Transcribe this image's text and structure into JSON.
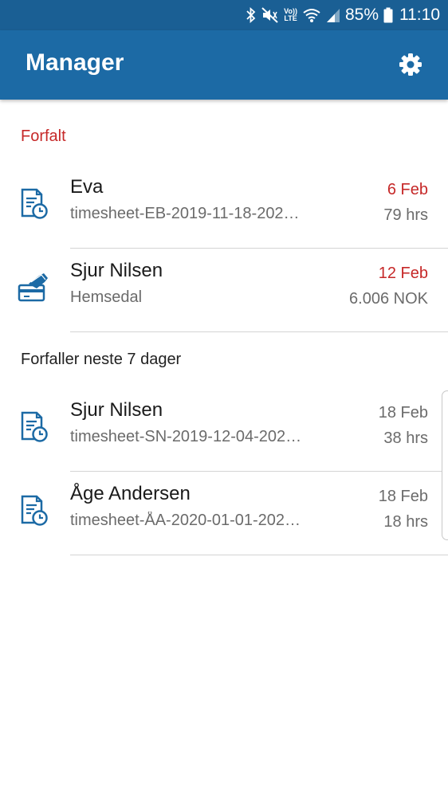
{
  "status_bar": {
    "icons": [
      "bluetooth-icon",
      "mute-icon",
      "volte-icon",
      "wifi-icon",
      "signal-icon",
      "battery-icon"
    ],
    "volte_top": "Vo))",
    "volte_bottom": "LTE",
    "battery": "85%",
    "time": "11:10"
  },
  "app_bar": {
    "title": "Manager",
    "settings_icon": "gear-icon"
  },
  "sections": {
    "overdue": {
      "title": "Forfalt",
      "items": [
        {
          "icon": "timesheet-icon",
          "name": "Eva",
          "sub": "timesheet-EB-2019-11-18-202…",
          "date": "6 Feb",
          "amount": "79 hrs",
          "date_color": "#c62828"
        },
        {
          "icon": "payment-icon",
          "name": "Sjur Nilsen",
          "sub": "Hemsedal",
          "date": "12 Feb",
          "amount": "6.006 NOK",
          "date_color": "#c62828"
        }
      ]
    },
    "upcoming": {
      "title": "Forfaller neste 7 dager",
      "items": [
        {
          "icon": "timesheet-icon",
          "name": "Sjur Nilsen",
          "sub": "timesheet-SN-2019-12-04-202…",
          "date": "18 Feb",
          "amount": "38 hrs"
        },
        {
          "icon": "timesheet-icon",
          "name": "Åge Andersen",
          "sub": "timesheet-ÅA-2020-01-01-202…",
          "date": "18 Feb",
          "amount": "18 hrs"
        }
      ]
    }
  },
  "colors": {
    "status_bar": "#1a5f94",
    "app_bar": "#1c6aa5",
    "overdue": "#c62828",
    "icon": "#1c6aa5"
  }
}
